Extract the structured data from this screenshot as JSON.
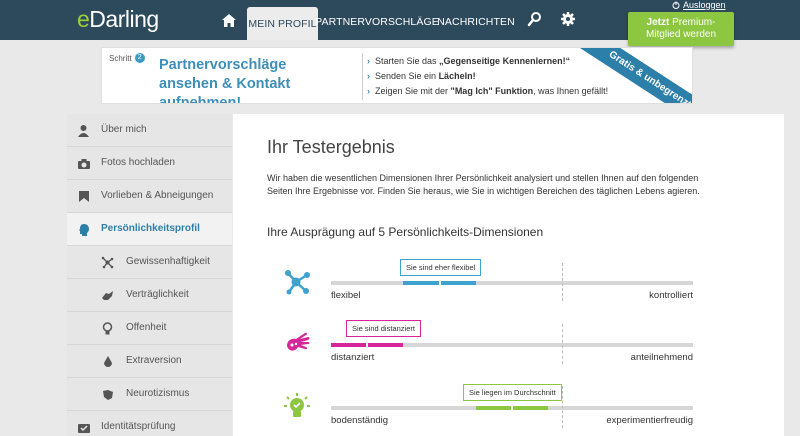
{
  "brand": {
    "logo_e": "e",
    "logo_rest": "Darling",
    "accent": "#9ccd3a",
    "header_bg": "#2d4a5c"
  },
  "nav": {
    "tabs": [
      {
        "label": "Mein Profil",
        "active": true
      },
      {
        "label": "Partnervorschläge",
        "active": false
      },
      {
        "label": "Nachrichten",
        "active": false
      }
    ],
    "logout_label": "Ausloggen",
    "premium_bold": "Jetzt",
    "premium_line1": " Premium-",
    "premium_line2": "Mitglied werden",
    "icons": [
      "home-icon",
      "search-user-icon",
      "gear-icon"
    ]
  },
  "banner": {
    "step_label": "Schritt",
    "step_number": "2",
    "headline": "Partnervorschläge ansehen & Kontakt aufnehmen!",
    "items": [
      {
        "pre": "Starten Sie das ",
        "bold": "„Gegenseitige Kennenlernen!“",
        "post": ""
      },
      {
        "pre": "Senden Sie ein ",
        "bold": "Lächeln!",
        "post": ""
      },
      {
        "pre": "Zeigen Sie mit der ",
        "bold": "\"Mag Ich\" Funktion",
        "post": ", was Ihnen gefällt!"
      }
    ],
    "ribbon": "Gratis & unbegrenzt!"
  },
  "sidebar": {
    "items": [
      {
        "label": "Über mich",
        "icon": "person-icon",
        "sub": false,
        "active": false
      },
      {
        "label": "Fotos hochladen",
        "icon": "camera-icon",
        "sub": false,
        "active": false
      },
      {
        "label": "Vorlieben & Abneigungen",
        "icon": "flag-icon",
        "sub": false,
        "active": false
      },
      {
        "label": "Persönlichkeitsprofil",
        "icon": "head-icon",
        "sub": false,
        "active": true
      },
      {
        "label": "Gewissenhaftigkeit",
        "icon": "molecule-icon",
        "sub": true,
        "active": false
      },
      {
        "label": "Verträglichkeit",
        "icon": "handshake-icon",
        "sub": true,
        "active": false
      },
      {
        "label": "Offenheit",
        "icon": "lightbulb-icon",
        "sub": true,
        "active": false
      },
      {
        "label": "Extraversion",
        "icon": "drop-icon",
        "sub": true,
        "active": false
      },
      {
        "label": "Neurotizismus",
        "icon": "leaf-icon",
        "sub": true,
        "active": false
      },
      {
        "label": "Identitätsprüfung",
        "icon": "id-check-icon",
        "sub": false,
        "active": false
      }
    ]
  },
  "main": {
    "title": "Ihr Testergebnis",
    "intro": "Wir haben die wesentlichen Dimensionen Ihrer Persönlichkeit analysiert und stellen Ihnen auf den folgenden Seiten Ihre Ergebnisse vor. Finden Sie heraus, wie Sie in wichtigen Bereichen des täglichen Lebens agieren.",
    "subheading": "Ihre Ausprägung auf 5 Persönlichkeits-Dimensionen",
    "dimensions": [
      {
        "icon": "molecule-icon",
        "color": "#3ea2cf",
        "left": "flexibel",
        "right": "kontrolliert",
        "bubble": "Sie sind eher flexibel",
        "fill_from": 0.2,
        "fill_to": 0.4
      },
      {
        "icon": "hand-icon",
        "color": "#d6279a",
        "left": "distanziert",
        "right": "anteilnehmend",
        "bubble": "Sie sind distanziert",
        "fill_from": 0.0,
        "fill_to": 0.2
      },
      {
        "icon": "lightbulb-icon",
        "color": "#8dc641",
        "left": "bodenständig",
        "right": "experimentierfreudig",
        "bubble": "Sie liegen im Durchschnitt",
        "fill_from": 0.4,
        "fill_to": 0.6
      }
    ]
  }
}
